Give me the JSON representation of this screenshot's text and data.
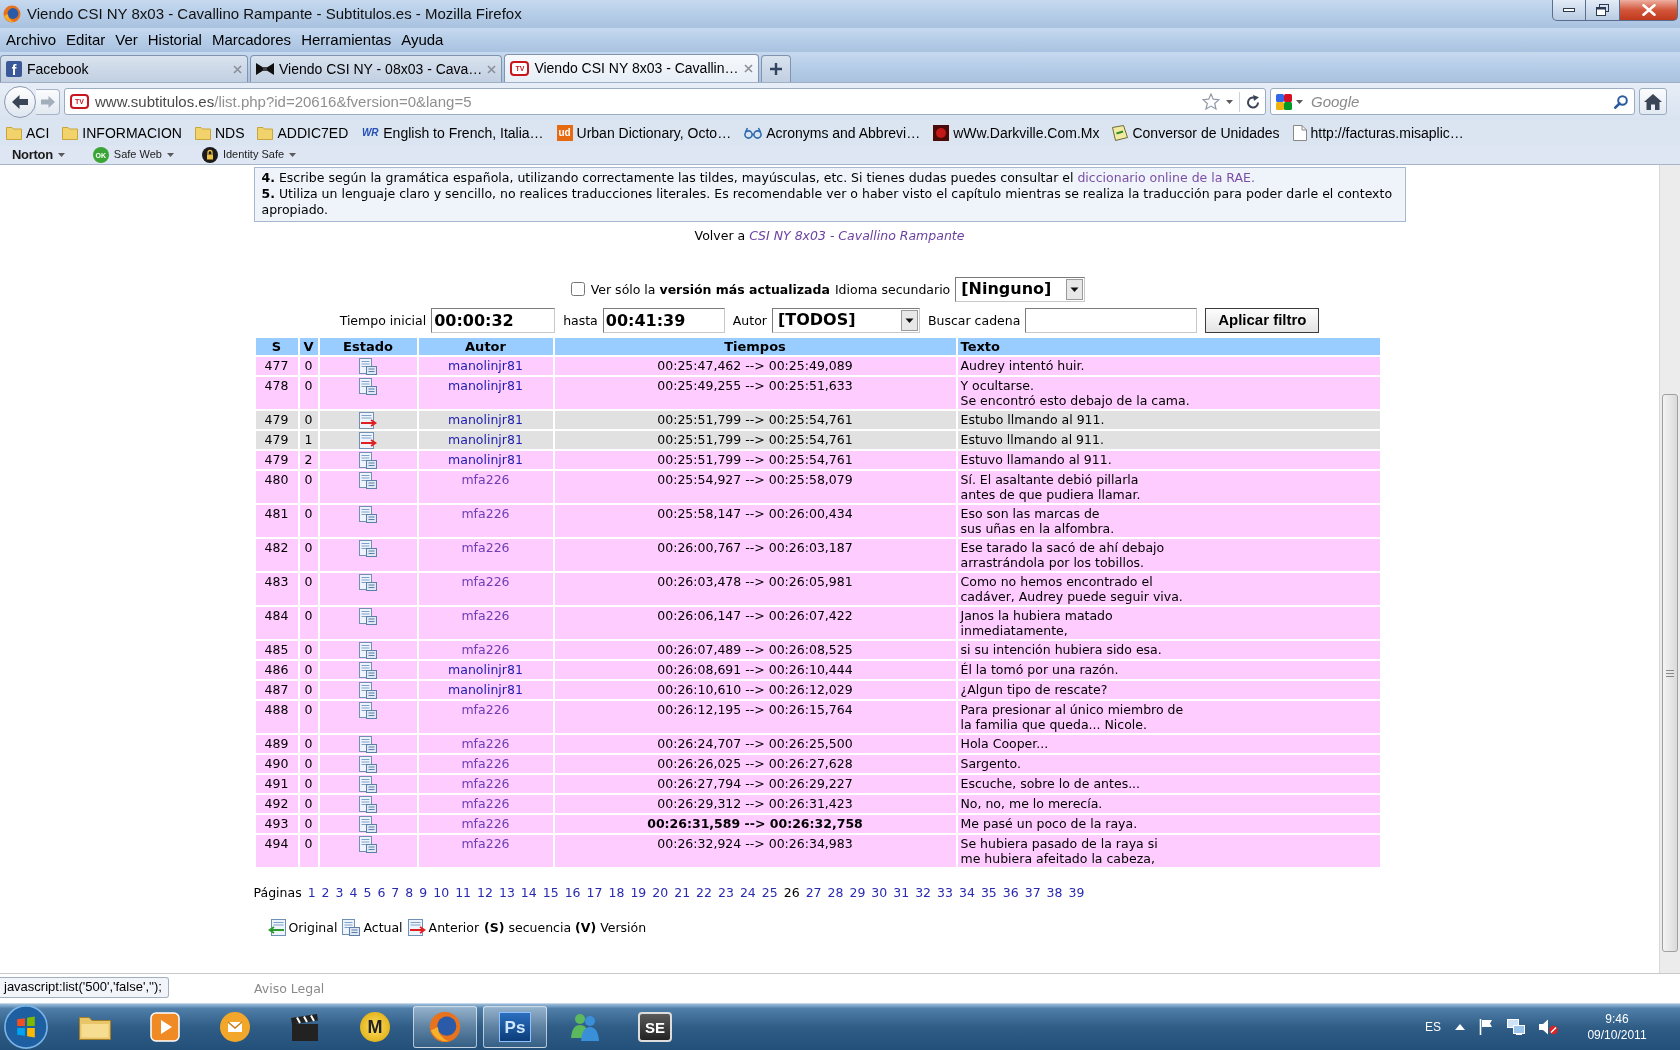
{
  "window": {
    "title": "Viendo CSI NY 8x03 - Cavallino Rampante - Subtitulos.es - Mozilla Firefox"
  },
  "menu": [
    "Archivo",
    "Editar",
    "Ver",
    "Historial",
    "Marcadores",
    "Herramientas",
    "Ayuda"
  ],
  "tabs": [
    {
      "label": "Facebook",
      "kind": "facebook",
      "favicon_text": "f",
      "selected": false
    },
    {
      "label": "Viendo CSI NY - 08x03 - Cava…",
      "kind": "bowtie",
      "selected": false
    },
    {
      "label": "Viendo CSI NY 8x03 - Cavallin…",
      "kind": "tv",
      "favicon_text": "TV",
      "selected": true
    }
  ],
  "navigation": {
    "favicon_text": "TV",
    "host": "www.subtitulos.es",
    "path": "/list.php?id=20616&fversion=0&lang=5",
    "search_placeholder": "Google"
  },
  "bookmarks": [
    {
      "kind": "folder",
      "label": "ACI"
    },
    {
      "kind": "folder",
      "label": "INFORMACION"
    },
    {
      "kind": "folder",
      "label": "NDS"
    },
    {
      "kind": "folder",
      "label": "ADDIC7ED"
    },
    {
      "kind": "letters",
      "icon_text": "WR",
      "label": "English to French, Italia…"
    },
    {
      "kind": "tile",
      "icon_text": "ud",
      "label": "Urban Dictionary, Octo…"
    },
    {
      "kind": "glasses",
      "label": "Acronyms and Abbrevi…"
    },
    {
      "kind": "square",
      "label": "wWw.Darkville.Com.Mx"
    },
    {
      "kind": "note",
      "label": "Conversor de Unidades"
    },
    {
      "kind": "page",
      "label": "http://facturas.misaplic…"
    }
  ],
  "norton_toolbar": [
    {
      "kind": "brand",
      "label": "Norton"
    },
    {
      "kind": "badge",
      "icon_text": "OK",
      "label": "Safe Web"
    },
    {
      "kind": "lock",
      "label": "Identity Safe"
    }
  ],
  "page": {
    "rules": [
      {
        "text": "**4.** Escribe según la gramática española, utilizando correctamente las tildes, mayúsculas, etc. Si tienes dudas puedes consultar el",
        "link": "diccionario online de la RAE."
      },
      {
        "text": "**5.** Utiliza un lenguaje claro y sencillo, no realices traducciones literales. Es recomendable ver o haber visto el capítulo mientras se realiza la traducción para poder darle el contexto apropiado."
      }
    ],
    "back": {
      "label": "Volver a",
      "link": "CSI NY 8x03 - Cavallino Rampante"
    },
    "filters": {
      "latest_only": {
        "label": "Ver sólo la **versión más actualizada**",
        "checked": false
      },
      "secondary_language": {
        "label": "Idioma secundario",
        "value": "[Ninguno]"
      },
      "start_time": {
        "label": "Tiempo inicial",
        "value": "00:00:32"
      },
      "end_time": {
        "label": "hasta",
        "value": "00:41:39"
      },
      "author": {
        "label": "Autor",
        "value": "[TODOS]"
      },
      "search": {
        "label": "Buscar cadena"
      },
      "apply_button": "Aplicar filtro"
    },
    "table": {
      "columns": [
        "S",
        "V",
        "Estado",
        "Autor",
        "Tiempos",
        "Texto"
      ],
      "rows": [
        {
          "s": "477",
          "v": "0",
          "kind": "actual",
          "author": "manolinjr81",
          "visited": false,
          "times": "00:25:47,462 --> 00:25:49,089",
          "emphasized": false,
          "text": [
            "Audrey intentó huir."
          ]
        },
        {
          "s": "478",
          "v": "0",
          "kind": "actual",
          "author": "manolinjr81",
          "visited": false,
          "times": "00:25:49,255 --> 00:25:51,633",
          "emphasized": false,
          "text": [
            "Y ocultarse.",
            "Se encontró esto debajo de la cama."
          ]
        },
        {
          "s": "479",
          "v": "0",
          "kind": "anterior",
          "author": "manolinjr81",
          "visited": false,
          "times": "00:25:51,799 --> 00:25:54,761",
          "emphasized": false,
          "text": [
            "Estubo llmando al 911."
          ]
        },
        {
          "s": "479",
          "v": "1",
          "kind": "anterior",
          "author": "manolinjr81",
          "visited": false,
          "times": "00:25:51,799 --> 00:25:54,761",
          "emphasized": false,
          "text": [
            "Estuvo llmando al 911."
          ]
        },
        {
          "s": "479",
          "v": "2",
          "kind": "actual",
          "author": "manolinjr81",
          "visited": false,
          "times": "00:25:51,799 --> 00:25:54,761",
          "emphasized": false,
          "text": [
            "Estuvo llamando al 911."
          ]
        },
        {
          "s": "480",
          "v": "0",
          "kind": "actual",
          "author": "mfa226",
          "visited": true,
          "times": "00:25:54,927 --> 00:25:58,079",
          "emphasized": false,
          "text": [
            "Sí. El asaltante debió pillarla",
            "antes de que pudiera llamar."
          ]
        },
        {
          "s": "481",
          "v": "0",
          "kind": "actual",
          "author": "mfa226",
          "visited": true,
          "times": "00:25:58,147 --> 00:26:00,434",
          "emphasized": false,
          "text": [
            "Eso son las marcas de",
            "sus uñas en la alfombra."
          ]
        },
        {
          "s": "482",
          "v": "0",
          "kind": "actual",
          "author": "mfa226",
          "visited": true,
          "times": "00:26:00,767 --> 00:26:03,187",
          "emphasized": false,
          "text": [
            "Ese tarado la sacó de ahí debajo",
            "arrastrándola por los tobillos."
          ]
        },
        {
          "s": "483",
          "v": "0",
          "kind": "actual",
          "author": "mfa226",
          "visited": true,
          "times": "00:26:03,478 --> 00:26:05,981",
          "emphasized": false,
          "text": [
            "Como no hemos encontrado el",
            "cadáver, Audrey puede seguir viva."
          ]
        },
        {
          "s": "484",
          "v": "0",
          "kind": "actual",
          "author": "mfa226",
          "visited": true,
          "times": "00:26:06,147 --> 00:26:07,422",
          "emphasized": false,
          "text": [
            "Janos la hubiera matado",
            "inmediatamente,"
          ]
        },
        {
          "s": "485",
          "v": "0",
          "kind": "actual",
          "author": "mfa226",
          "visited": true,
          "times": "00:26:07,489 --> 00:26:08,525",
          "emphasized": false,
          "text": [
            "si su intención hubiera sido esa."
          ]
        },
        {
          "s": "486",
          "v": "0",
          "kind": "actual",
          "author": "manolinjr81",
          "visited": false,
          "times": "00:26:08,691 --> 00:26:10,444",
          "emphasized": false,
          "text": [
            "Él la tomó por una razón."
          ]
        },
        {
          "s": "487",
          "v": "0",
          "kind": "actual",
          "author": "manolinjr81",
          "visited": false,
          "times": "00:26:10,610 --> 00:26:12,029",
          "emphasized": false,
          "text": [
            "¿Algun tipo de rescate?"
          ]
        },
        {
          "s": "488",
          "v": "0",
          "kind": "actual",
          "author": "mfa226",
          "visited": true,
          "times": "00:26:12,195 --> 00:26:15,764",
          "emphasized": false,
          "text": [
            "Para presionar al único miembro de",
            "la familia que queda... Nicole."
          ]
        },
        {
          "s": "489",
          "v": "0",
          "kind": "actual",
          "author": "mfa226",
          "visited": true,
          "times": "00:26:24,707 --> 00:26:25,500",
          "emphasized": false,
          "text": [
            "Hola Cooper..."
          ]
        },
        {
          "s": "490",
          "v": "0",
          "kind": "actual",
          "author": "mfa226",
          "visited": true,
          "times": "00:26:26,025 --> 00:26:27,628",
          "emphasized": false,
          "text": [
            "Sargento."
          ]
        },
        {
          "s": "491",
          "v": "0",
          "kind": "actual",
          "author": "mfa226",
          "visited": true,
          "times": "00:26:27,794 --> 00:26:29,227",
          "emphasized": false,
          "text": [
            "Escuche, sobre lo de antes..."
          ]
        },
        {
          "s": "492",
          "v": "0",
          "kind": "actual",
          "author": "mfa226",
          "visited": true,
          "times": "00:26:29,312 --> 00:26:31,423",
          "emphasized": false,
          "text": [
            "No, no, me lo merecía."
          ]
        },
        {
          "s": "493",
          "v": "0",
          "kind": "actual",
          "author": "mfa226",
          "visited": true,
          "times": "00:26:31,589 --> 00:26:32,758",
          "emphasized": true,
          "text": [
            "Me pasé un poco de la raya."
          ]
        },
        {
          "s": "494",
          "v": "0",
          "kind": "actual",
          "author": "mfa226",
          "visited": true,
          "times": "00:26:32,924 --> 00:26:34,983",
          "emphasized": false,
          "text": [
            "Se hubiera pasado de la raya si",
            "me hubiera afeitado la cabeza,"
          ]
        }
      ]
    },
    "pagination": {
      "label": "Páginas",
      "pages": [
        {
          "label": "1",
          "selected": false
        },
        {
          "label": "2",
          "selected": false
        },
        {
          "label": "3",
          "selected": false
        },
        {
          "label": "4",
          "selected": false
        },
        {
          "label": "5",
          "selected": false
        },
        {
          "label": "6",
          "selected": false
        },
        {
          "label": "7",
          "selected": false
        },
        {
          "label": "8",
          "selected": false
        },
        {
          "label": "9",
          "selected": false
        },
        {
          "label": "10",
          "selected": false
        },
        {
          "label": "11",
          "selected": false
        },
        {
          "label": "12",
          "selected": false
        },
        {
          "label": "13",
          "selected": false
        },
        {
          "label": "14",
          "selected": false
        },
        {
          "label": "15",
          "selected": false
        },
        {
          "label": "16",
          "selected": false
        },
        {
          "label": "17",
          "selected": false
        },
        {
          "label": "18",
          "selected": false
        },
        {
          "label": "19",
          "selected": false
        },
        {
          "label": "20",
          "selected": false
        },
        {
          "label": "21",
          "selected": false
        },
        {
          "label": "22",
          "selected": false
        },
        {
          "label": "23",
          "selected": false
        },
        {
          "label": "24",
          "selected": false
        },
        {
          "label": "25",
          "selected": false
        },
        {
          "label": "26",
          "selected": true
        },
        {
          "label": "27",
          "selected": false
        },
        {
          "label": "28",
          "selected": false
        },
        {
          "label": "29",
          "selected": false
        },
        {
          "label": "30",
          "selected": false
        },
        {
          "label": "31",
          "selected": false
        },
        {
          "label": "32",
          "selected": false
        },
        {
          "label": "33",
          "selected": false
        },
        {
          "label": "34",
          "selected": false
        },
        {
          "label": "35",
          "selected": false
        },
        {
          "label": "36",
          "selected": false
        },
        {
          "label": "37",
          "selected": false
        },
        {
          "label": "38",
          "selected": false
        },
        {
          "label": "39",
          "selected": false
        }
      ]
    },
    "legend": {
      "items": [
        {
          "kind": "original",
          "label": "Original"
        },
        {
          "kind": "actual",
          "label": "Actual"
        },
        {
          "kind": "anterior",
          "label": "Anterior"
        }
      ],
      "keys": "**(S)** secuencia **(V)** Versión"
    },
    "footer_link": "Aviso Legal"
  },
  "status_text": "javascript:list('500','false','');",
  "taskbar": {
    "apps": [
      {
        "kind": "folder",
        "active": false
      },
      {
        "kind": "player",
        "active": false
      },
      {
        "kind": "mail",
        "active": false
      },
      {
        "kind": "clapper",
        "active": false
      },
      {
        "kind": "round_tile",
        "icon_text": "M",
        "active": false
      },
      {
        "kind": "globe",
        "active": true
      },
      {
        "kind": "blue_tile",
        "icon_text": "Ps",
        "active": true
      },
      {
        "kind": "people",
        "active": false
      },
      {
        "kind": "dark_tile",
        "icon_text": "SE",
        "active": false
      }
    ],
    "language": "ES",
    "time": "9:46",
    "date": "09/10/2011"
  }
}
